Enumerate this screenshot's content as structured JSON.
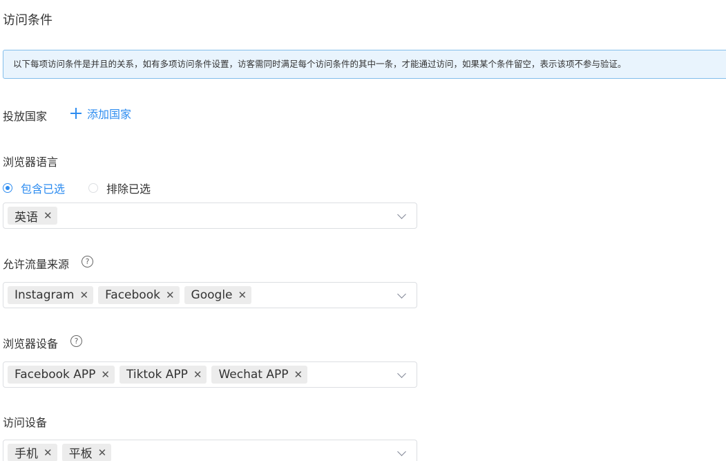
{
  "section_title": "访问条件",
  "info_banner": "以下每项访问条件是并且的关系，如有多项访问条件设置，访客需同时满足每个访问条件的其中一条，才能通过访问，如果某个条件留空，表示该项不参与验证。",
  "country": {
    "label": "投放国家",
    "add_label": "添加国家"
  },
  "browser_language": {
    "label": "浏览器语言",
    "radio_include": "包含已选",
    "radio_exclude": "排除已选",
    "selected": "include",
    "tags": [
      "英语"
    ]
  },
  "traffic_source": {
    "label": "允许流量来源",
    "tags": [
      "Instagram",
      "Facebook",
      "Google"
    ]
  },
  "browser_device": {
    "label": "浏览器设备",
    "tags": [
      "Facebook APP",
      "Tiktok APP",
      "Wechat APP"
    ]
  },
  "access_device": {
    "label": "访问设备",
    "tags": [
      "手机",
      "平板"
    ]
  },
  "help_glyph": "?",
  "close_glyph": "✕",
  "colors": {
    "accent": "#2d8cf0",
    "banner_bg": "#e9f4fd",
    "banner_border": "#82bdeb",
    "tag_bg": "#ececec"
  }
}
